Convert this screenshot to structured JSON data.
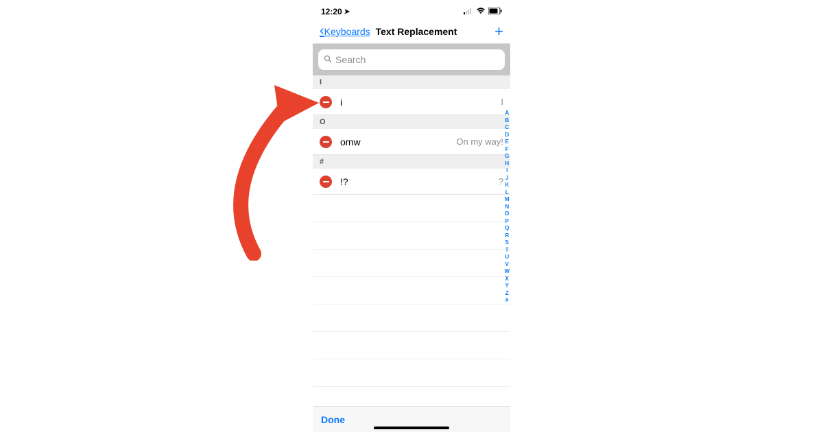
{
  "status": {
    "time": "12:20",
    "location_icon": "➤"
  },
  "nav": {
    "back": "Keyboards",
    "title": "Text Replacement",
    "add": "+"
  },
  "search": {
    "placeholder": "Search"
  },
  "sections": [
    {
      "head": "I",
      "items": [
        {
          "short": "i",
          "phrase": "I"
        }
      ]
    },
    {
      "head": "O",
      "items": [
        {
          "short": "omw",
          "phrase": "On my way!"
        }
      ]
    },
    {
      "head": "#",
      "items": [
        {
          "short": "!?",
          "phrase": "?"
        }
      ]
    }
  ],
  "index": [
    "A",
    "B",
    "C",
    "D",
    "E",
    "F",
    "G",
    "H",
    "I",
    "J",
    "K",
    "L",
    "M",
    "N",
    "O",
    "P",
    "Q",
    "R",
    "S",
    "T",
    "U",
    "V",
    "W",
    "X",
    "Y",
    "Z",
    "#"
  ],
  "footer": {
    "done": "Done"
  }
}
